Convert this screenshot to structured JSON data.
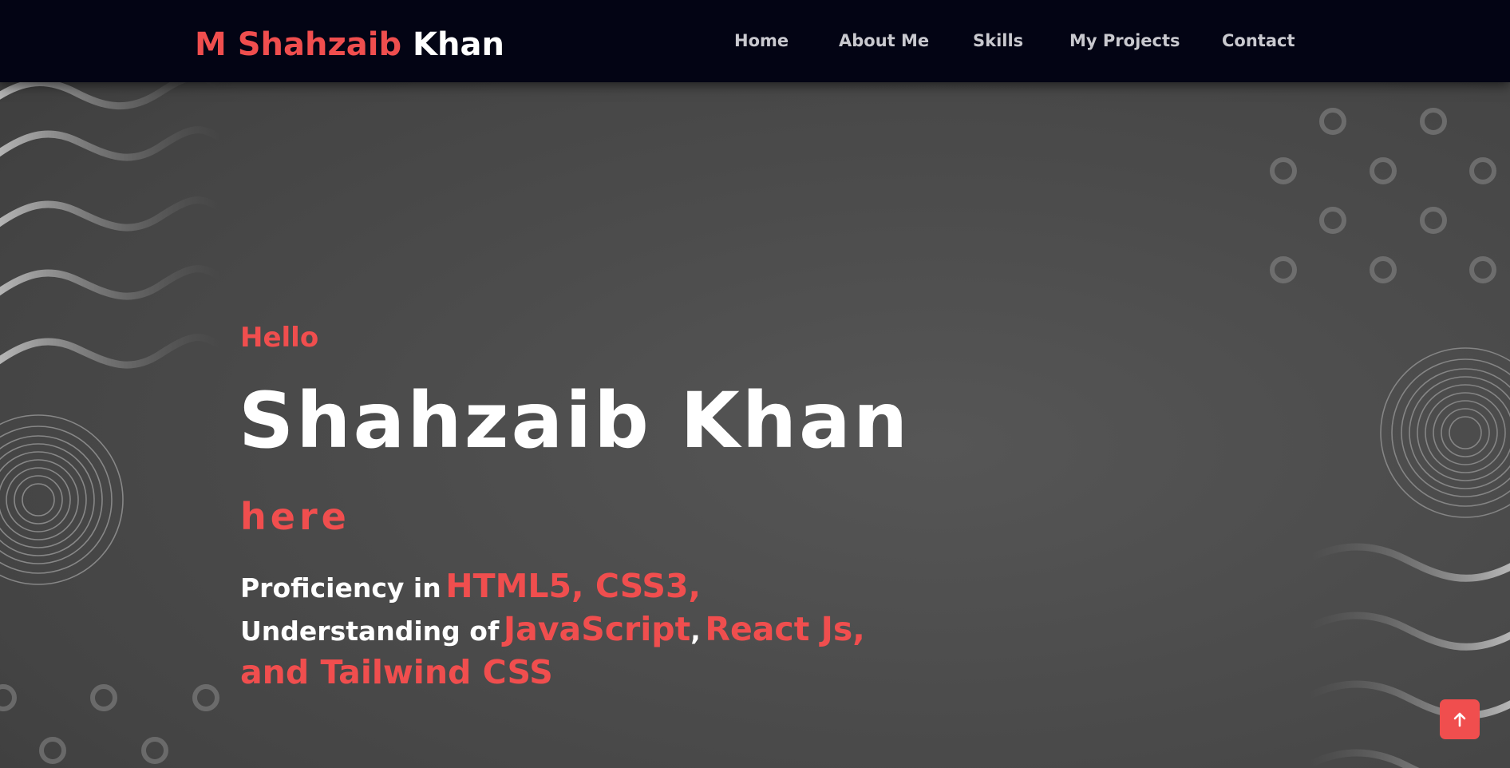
{
  "brand": {
    "first": "M Shahzaib",
    "last": "Khan"
  },
  "nav": {
    "items": [
      {
        "label": "Home"
      },
      {
        "label": "About Me"
      },
      {
        "label": "Skills"
      },
      {
        "label": "My Projects"
      },
      {
        "label": "Contact"
      }
    ]
  },
  "hero": {
    "greeting": "Hello",
    "name": "Shahzaib Khan",
    "suffix": "here",
    "line1_prefix": "Proficiency in",
    "line1_highlight": "HTML5, CSS3,",
    "line2_prefix": "Understanding of",
    "line2_highlight_a": "JavaScript",
    "line2_separator": ",",
    "line2_highlight_b": "React Js,",
    "line3_highlight": "and Tailwind CSS"
  },
  "scroll_top": {
    "icon": "arrow-up-icon"
  },
  "colors": {
    "accent": "#f04e4e",
    "navbar": "#030414",
    "background": "#4c4c4c"
  }
}
